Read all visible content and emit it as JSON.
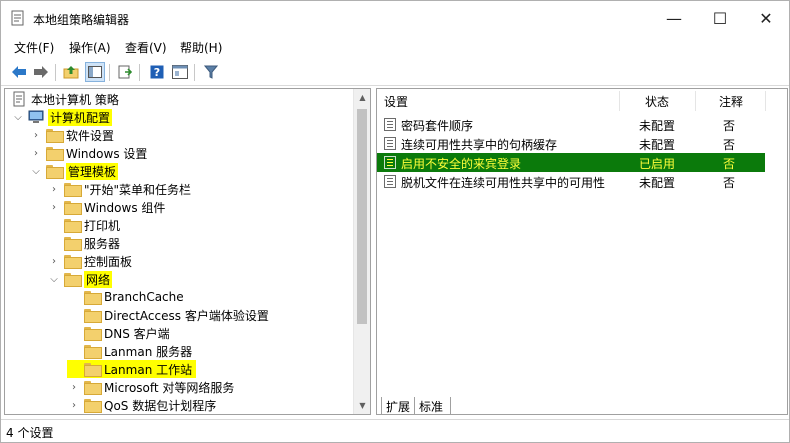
{
  "window": {
    "title": "本地组策略编辑器",
    "controls": {
      "minimize": "—",
      "maximize": "☐",
      "close": "✕"
    }
  },
  "menu": [
    "文件(F)",
    "操作(A)",
    "查看(V)",
    "帮助(H)"
  ],
  "toolbar": {
    "icons": [
      "back-icon",
      "forward-icon",
      "up-folder-icon",
      "show-hide-tree-icon",
      "export-list-icon",
      "help-icon",
      "properties-icon",
      "filter-icon"
    ]
  },
  "tree": {
    "items": [
      {
        "label": "本地计算机 策略",
        "expander": "",
        "icon": "computer-policy-icon"
      },
      {
        "label": "计算机配置",
        "expander": "⌵",
        "icon": "computer-icon",
        "highlight": true
      },
      {
        "label": "软件设置",
        "expander": "›",
        "icon": "folder-icon"
      },
      {
        "label": "Windows 设置",
        "expander": "›",
        "icon": "folder-icon"
      },
      {
        "label": "管理模板",
        "expander": "⌵",
        "icon": "folder-icon",
        "highlight": true
      },
      {
        "label": "\"开始\"菜单和任务栏",
        "expander": "›",
        "icon": "folder-icon"
      },
      {
        "label": "Windows 组件",
        "expander": "›",
        "icon": "folder-icon"
      },
      {
        "label": "打印机",
        "expander": "",
        "icon": "folder-icon"
      },
      {
        "label": "服务器",
        "expander": "",
        "icon": "folder-icon"
      },
      {
        "label": "控制面板",
        "expander": "›",
        "icon": "folder-icon"
      },
      {
        "label": "网络",
        "expander": "⌵",
        "icon": "folder-icon",
        "highlight": true
      },
      {
        "label": "BranchCache",
        "expander": "",
        "icon": "folder-icon"
      },
      {
        "label": "DirectAccess 客户端体验设置",
        "expander": "",
        "icon": "folder-icon"
      },
      {
        "label": "DNS 客户端",
        "expander": "",
        "icon": "folder-icon"
      },
      {
        "label": "Lanman 服务器",
        "expander": "",
        "icon": "folder-icon"
      },
      {
        "label": "Lanman 工作站",
        "expander": "",
        "icon": "folder-icon",
        "highlight": true
      },
      {
        "label": "Microsoft 对等网络服务",
        "expander": "›",
        "icon": "folder-icon"
      },
      {
        "label": "QoS 数据包计划程序",
        "expander": "›",
        "icon": "folder-icon"
      }
    ]
  },
  "list": {
    "headers": {
      "setting": "设置",
      "state": "状态",
      "comment": "注释"
    },
    "rows": [
      {
        "setting": "密码套件顺序",
        "state": "未配置",
        "comment": "否"
      },
      {
        "setting": "连续可用性共享中的句柄缓存",
        "state": "未配置",
        "comment": "否"
      },
      {
        "setting": "启用不安全的来宾登录",
        "state": "已启用",
        "comment": "否",
        "selected": true
      },
      {
        "setting": "脱机文件在连续可用性共享中的可用性",
        "state": "未配置",
        "comment": "否"
      }
    ]
  },
  "tabs": [
    "扩展",
    "标准"
  ],
  "status": "4 个设置",
  "colors": {
    "highlight": "#ffff00",
    "selected_row_bg": "#0b7a0b",
    "selected_row_text": "#ffff3a"
  }
}
